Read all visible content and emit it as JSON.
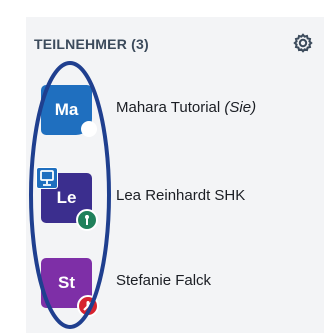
{
  "panel": {
    "title": "TEILNEHMER (3)"
  },
  "participants": [
    {
      "initials": "Ma",
      "name": "Mahara Tutorial",
      "suffix": "(Sie)",
      "color": "#1f6fbf"
    },
    {
      "initials": "Le",
      "name": "Lea Reinhardt SHK",
      "color": "#3b2e8e",
      "badges": [
        "presenter-icon",
        "moderator-icon"
      ]
    },
    {
      "initials": "St",
      "name": "Stefanie Falck",
      "color": "#7e2fa7",
      "badges": [
        "muted-microphone-icon"
      ]
    }
  ],
  "annotation": {
    "shape": "ellipse",
    "color": "#1f3f8f"
  }
}
